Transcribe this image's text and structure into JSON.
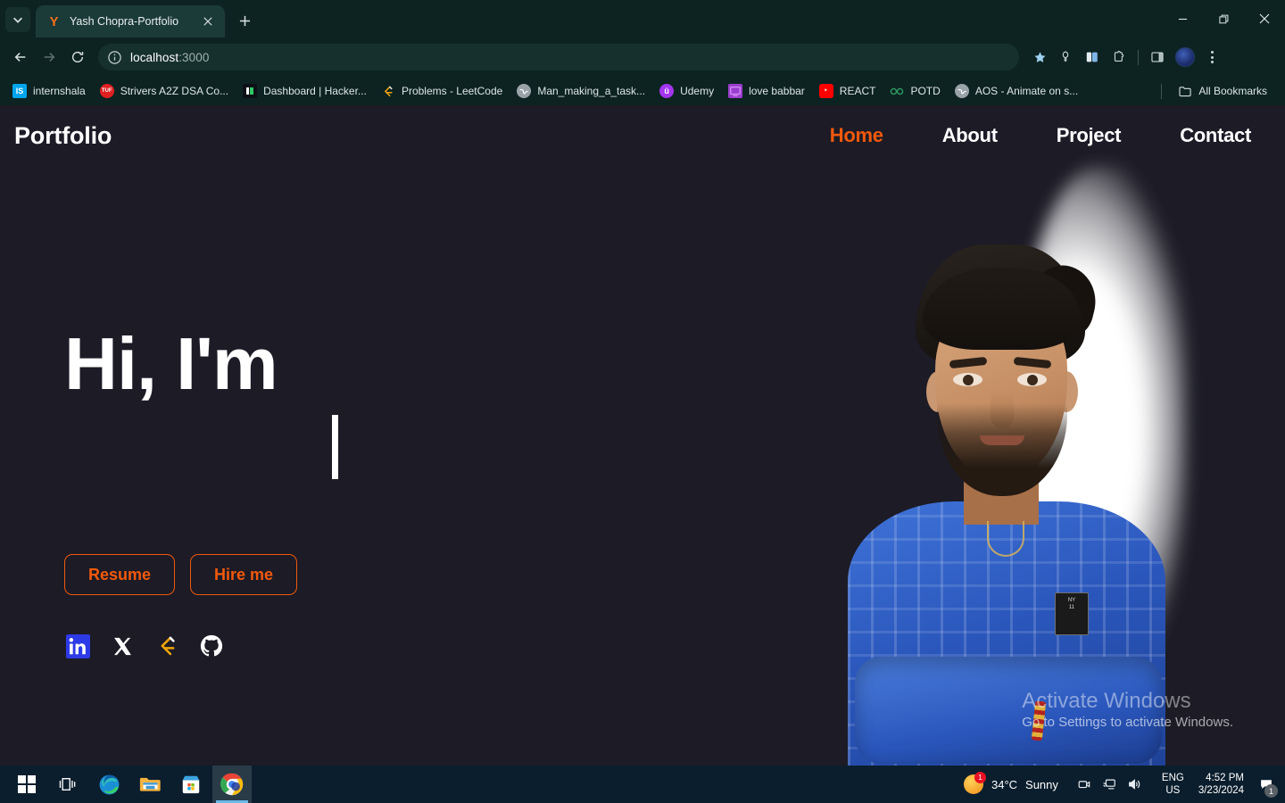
{
  "browser": {
    "tab": {
      "title": "Yash Chopra-Portfolio",
      "favicon": "Y"
    },
    "new_tab_label": "+",
    "window_controls": {
      "minimize": "minimize-icon",
      "restore": "restore-icon",
      "close": "close-icon"
    },
    "address": {
      "scheme_icon": "info-icon",
      "host": "localhost",
      "port": ":3000"
    },
    "toolbar_icons": [
      "bookmark-star-icon",
      "password-icon",
      "tab-group-icon",
      "extensions-icon",
      "side-panel-icon",
      "profile-avatar",
      "chrome-menu-icon"
    ],
    "bookmarks": [
      {
        "label": "internshala",
        "icon": "internshala-icon",
        "glyph": "IS"
      },
      {
        "label": "Strivers A2Z DSA Co...",
        "icon": "takeuforward-icon",
        "glyph": "TUF"
      },
      {
        "label": "Dashboard | Hacker...",
        "icon": "hackerrank-icon",
        "glyph": "HR"
      },
      {
        "label": "Problems - LeetCode",
        "icon": "leetcode-icon",
        "glyph": "ʃ"
      },
      {
        "label": "Man_making_a_task...",
        "icon": "globe-icon",
        "glyph": "♁"
      },
      {
        "label": "Udemy",
        "icon": "udemy-icon",
        "glyph": "û"
      },
      {
        "label": "love babbar",
        "icon": "youtube-channel-icon",
        "glyph": "▣"
      },
      {
        "label": "REACT",
        "icon": "youtube-icon",
        "glyph": "▶"
      },
      {
        "label": "POTD",
        "icon": "geeksforgeeks-icon",
        "glyph": "∞"
      },
      {
        "label": "AOS - Animate on s...",
        "icon": "globe-icon",
        "glyph": "♁"
      }
    ],
    "all_bookmarks_label": "All Bookmarks"
  },
  "site": {
    "brand": "Portfolio",
    "nav": [
      {
        "label": "Home",
        "active": true
      },
      {
        "label": "About",
        "active": false
      },
      {
        "label": "Project",
        "active": false
      },
      {
        "label": "Contact",
        "active": false
      }
    ],
    "hero": {
      "greeting": "Hi, I'm",
      "typed_text": "",
      "buttons": [
        {
          "label": "Resume"
        },
        {
          "label": "Hire me"
        }
      ],
      "socials": [
        {
          "name": "linkedin-icon"
        },
        {
          "name": "x-twitter-icon"
        },
        {
          "name": "leetcode-icon"
        },
        {
          "name": "github-icon"
        }
      ]
    },
    "accent_color": "#f2590c",
    "background_color": "#1c1b26"
  },
  "watermark": {
    "line1": "Activate Windows",
    "line2": "Go to Settings to activate Windows."
  },
  "taskbar": {
    "items": [
      {
        "name": "start-button"
      },
      {
        "name": "task-view-button"
      },
      {
        "name": "microsoft-edge-icon"
      },
      {
        "name": "file-explorer-icon"
      },
      {
        "name": "microsoft-store-icon"
      },
      {
        "name": "google-chrome-icon",
        "active": true
      }
    ],
    "weather": {
      "temperature": "34°C",
      "condition": "Sunny",
      "badge": "1"
    },
    "tray_icons": [
      "camera-icon",
      "display-cast-icon",
      "volume-icon"
    ],
    "language": {
      "line1": "ENG",
      "line2": "US"
    },
    "clock": {
      "time": "4:52 PM",
      "date": "3/23/2024"
    },
    "notification": {
      "badge": "1",
      "name": "notification-center-icon"
    }
  }
}
